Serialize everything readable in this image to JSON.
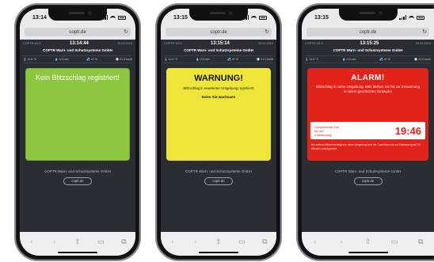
{
  "phones": [
    {
      "status_time": "13:14",
      "url": "coptr.de",
      "header": {
        "left": "COPTR WI-S",
        "clock": "13:14:44",
        "date": "25.02.2019"
      },
      "company": "COPTR Warn- und Schutzsysteme GmbH",
      "sensors": [
        "🌡 11.0 °C",
        "💧 0.3 mm",
        "💦 47 %",
        "💨 21.0 km/h"
      ],
      "state": "green",
      "message": "Kein Blitzschlag registriert!",
      "footer_company": "COPTR Warn- und Schutzsysteme GmbH",
      "site_button": "coptr.de"
    },
    {
      "status_time": "13:15",
      "url": "coptr.de",
      "header": {
        "left": "COPTR WI-S",
        "clock": "13:15:14",
        "date": "25.02.2019"
      },
      "company": "COPTR Warn- und Schutzsysteme GmbH",
      "sensors": [
        "🌡 11.0 °C",
        "💧 0.3 mm",
        "💦 47 %",
        "💨 21.0 km/h"
      ],
      "state": "yellow",
      "title": "WARNUNG!",
      "message": "Blitzschlag in erweiterter Umgebung registriert!",
      "sub": "Seien Sie wachsam!",
      "footer_company": "COPTR Warn- und Schutzsysteme GmbH",
      "site_button": "coptr.de"
    },
    {
      "status_time": "13:15",
      "url": "coptr.de",
      "header": {
        "left": "COPTR WI-S",
        "clock": "13:15:25",
        "date": "25.02.2019"
      },
      "company": "COPTR Warn- und Schutzsysteme GmbH",
      "sensors": [
        "🌡 11.0 °C",
        "💧 0.3 mm",
        "💦 47 %",
        "💨 21.0 km/h"
      ],
      "state": "red",
      "title": "ALARM!",
      "message": "Blitzschlag in naher Umgebung. Bitte bleiben Sie bis zur Entwarnung in einem geschützten Gebäude!",
      "countdown_label": "Verbleibende Zeit bis zur Entwarnung:",
      "countdown": "19:46",
      "note": "Bei weiteren Blitzeinschlägen in naher Umgebung wird der Countdown bis zur Entwarnung auf 20 Minuten zurückgesetzt.",
      "footer_company": "COPTR Warn- und Schutzsysteme GmbH",
      "site_button": "coptr.de"
    }
  ],
  "toolbar": [
    "‹",
    "›",
    "⇧",
    "▭",
    "⧉"
  ],
  "colors": {
    "green": "#8dc63f",
    "yellow": "#f0e63a",
    "red": "#e2231a",
    "page_bg": "#2a2d34"
  }
}
